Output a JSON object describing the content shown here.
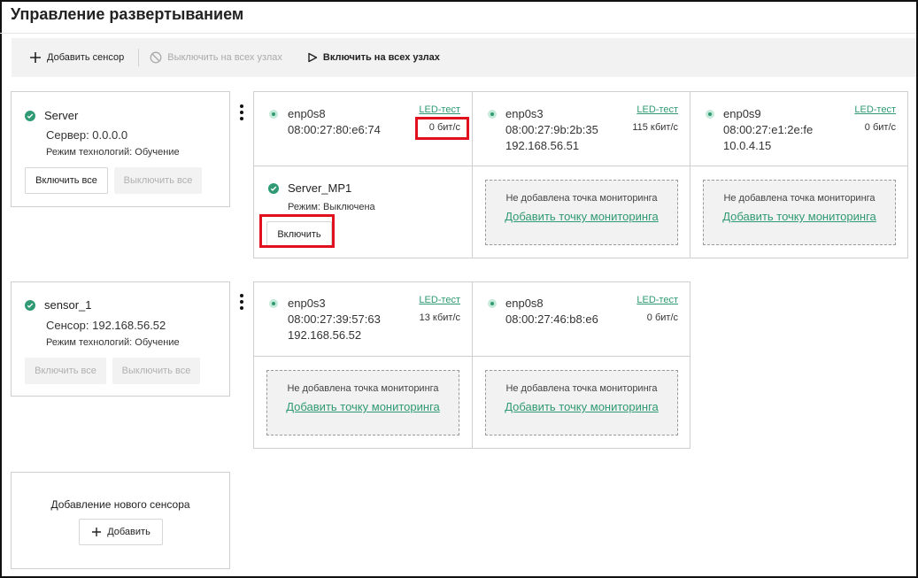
{
  "page": {
    "title": "Управление развертыванием"
  },
  "toolbar": {
    "add_sensor": "Добавить сенсор",
    "disable_all_nodes": "Выключить на всех узлах",
    "enable_all_nodes": "Включить на всех узлах"
  },
  "nodes": [
    {
      "name": "Server",
      "address": "Сервер: 0.0.0.0",
      "mode": "Режим технологий: Обучение",
      "enable_all": "Включить все",
      "disable_all": "Выключить все",
      "interfaces": [
        {
          "name": "enp0s8",
          "mac": "08:00:27:80:e6:74",
          "ip": "",
          "led": "LED-тест",
          "rate": "0 бит/с"
        },
        {
          "name": "enp0s3",
          "mac": "08:00:27:9b:2b:35",
          "ip": "192.168.56.51",
          "led": "LED-тест",
          "rate": "115 кбит/с"
        },
        {
          "name": "enp0s9",
          "mac": "08:00:27:e1:2e:fe",
          "ip": "10.0.4.15",
          "led": "LED-тест",
          "rate": "0 бит/с"
        }
      ],
      "monitoring_point": {
        "name": "Server_MP1",
        "mode": "Режим: Выключена",
        "enable_button": "Включить"
      }
    },
    {
      "name": "sensor_1",
      "address": "Сенсор: 192.168.56.52",
      "mode": "Режим технологий: Обучение",
      "enable_all": "Включить все",
      "disable_all": "Выключить все",
      "interfaces": [
        {
          "name": "enp0s3",
          "mac": "08:00:27:39:57:63",
          "ip": "192.168.56.52",
          "led": "LED-тест",
          "rate": "13 кбит/с"
        },
        {
          "name": "enp0s8",
          "mac": "08:00:27:46:b8:e6",
          "ip": "",
          "led": "LED-тест",
          "rate": "0 бит/с"
        }
      ]
    }
  ],
  "placeholder": {
    "text": "Не добавлена точка мониторинга",
    "link": "Добавить точку мониторинга"
  },
  "new_sensor": {
    "title": "Добавление нового сенсора",
    "add_button": "Добавить"
  },
  "colors": {
    "accent": "#2f9a73",
    "highlight": "#e0101e",
    "toolbar_bg": "#f2f2f2"
  }
}
